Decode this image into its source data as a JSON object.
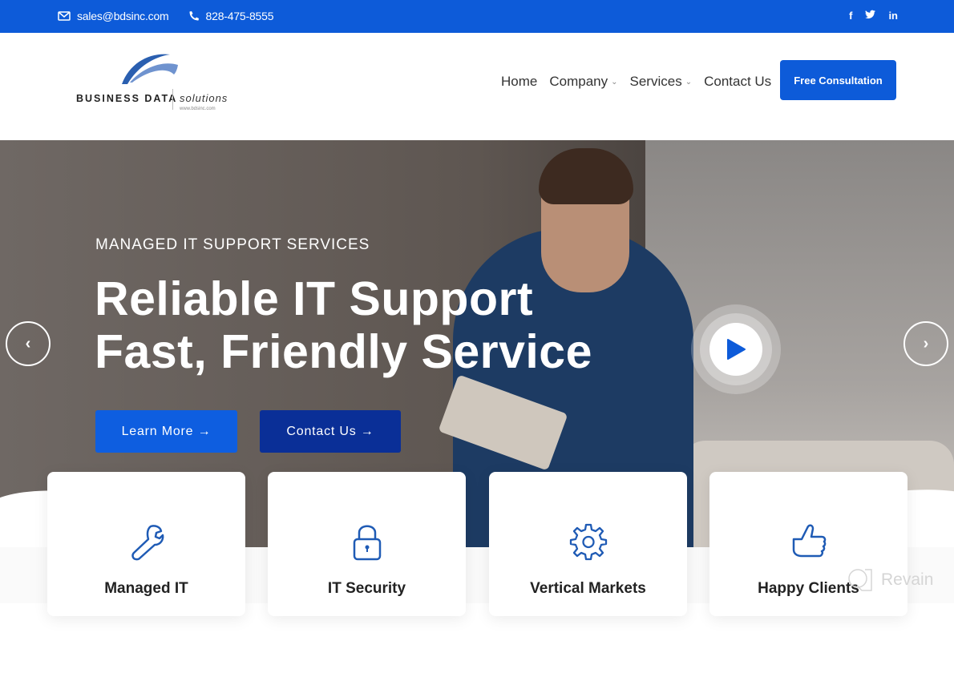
{
  "topbar": {
    "email": "sales@bdsinc.com",
    "phone": "828-475-8555",
    "social": [
      {
        "name": "facebook",
        "glyph": "f"
      },
      {
        "name": "twitter",
        "glyph": "🐦"
      },
      {
        "name": "linkedin",
        "glyph": "in"
      }
    ]
  },
  "logo": {
    "brand": "BUSINESS DATA",
    "tagline": "solutions",
    "url": "www.bdsinc.com"
  },
  "nav": {
    "items": [
      {
        "label": "Home",
        "has_dropdown": false
      },
      {
        "label": "Company",
        "has_dropdown": true
      },
      {
        "label": "Services",
        "has_dropdown": true
      },
      {
        "label": "Contact Us",
        "has_dropdown": false
      }
    ],
    "cta": "Free Consultation"
  },
  "hero": {
    "kicker": "MANAGED IT SUPPORT SERVICES",
    "headline_line1": "Reliable IT Support",
    "headline_line2": "Fast, Friendly Service",
    "learn_more": "Learn More →",
    "contact_us": "Contact Us →",
    "prev": "‹",
    "next": "›"
  },
  "features": [
    {
      "label": "Managed IT",
      "icon": "wrench-icon"
    },
    {
      "label": "IT Security",
      "icon": "lock-icon"
    },
    {
      "label": "Vertical Markets",
      "icon": "gear-icon"
    },
    {
      "label": "Happy Clients",
      "icon": "thumbs-up-icon"
    }
  ],
  "watermark": "Revain",
  "colors": {
    "primary": "#0d5bd9",
    "dark_blue": "#0a2f97",
    "icon_blue": "#1f5bb5"
  }
}
